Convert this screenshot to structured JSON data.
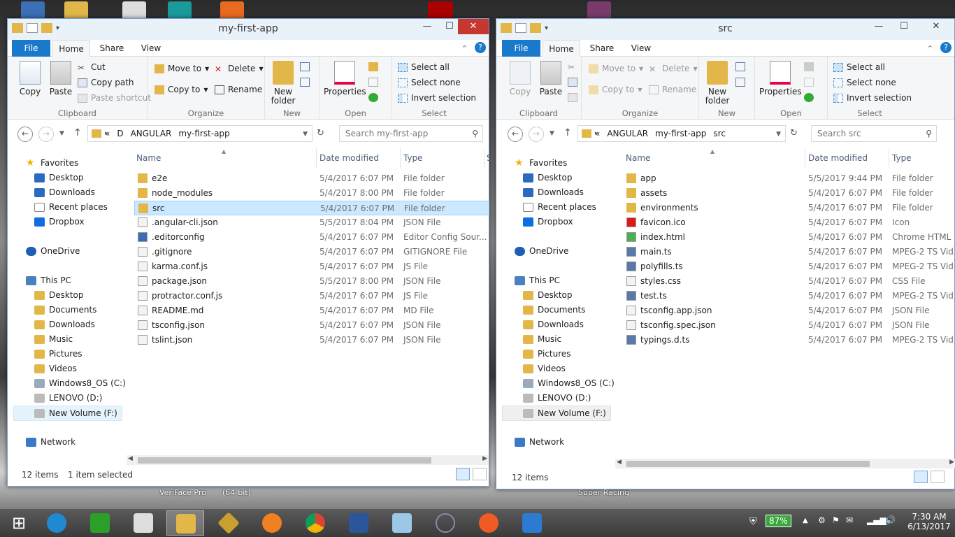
{
  "desktop": {
    "labels": [
      "VeriFace Pro",
      "(64-bit)",
      "Super Racing"
    ]
  },
  "left": {
    "title": "my-first-app",
    "tabs": [
      "File",
      "Home",
      "Share",
      "View"
    ],
    "ribbon": {
      "copy": "Copy",
      "paste": "Paste",
      "cut": "Cut",
      "copy_path": "Copy path",
      "paste_shortcut": "Paste shortcut",
      "clipboard": "Clipboard",
      "move_to": "Move to",
      "copy_to": "Copy to",
      "delete": "Delete",
      "rename": "Rename",
      "organize": "Organize",
      "new_folder": "New folder",
      "new": "New",
      "properties": "Properties",
      "open": "Open",
      "select_all": "Select all",
      "select_none": "Select none",
      "invert": "Invert selection",
      "select": "Select"
    },
    "breadcrumb": [
      "«",
      "D",
      "ANGULAR",
      "my-first-app"
    ],
    "search": "Search my-first-app",
    "nav": [
      "Favorites",
      "Desktop",
      "Downloads",
      "Recent places",
      "Dropbox",
      "OneDrive",
      "This PC",
      "Desktop",
      "Documents",
      "Downloads",
      "Music",
      "Pictures",
      "Videos",
      "Windows8_OS (C:)",
      "LENOVO (D:)",
      "New Volume (F:)",
      "Network"
    ],
    "columns": [
      "Name",
      "Date modified",
      "Type",
      "S"
    ],
    "files": [
      {
        "name": "e2e",
        "date": "5/4/2017 6:07 PM",
        "type": "File folder"
      },
      {
        "name": "node_modules",
        "date": "5/4/2017 8:00 PM",
        "type": "File folder"
      },
      {
        "name": "src",
        "date": "5/4/2017 6:07 PM",
        "type": "File folder"
      },
      {
        "name": ".angular-cli.json",
        "date": "5/5/2017 8:04 PM",
        "type": "JSON File"
      },
      {
        "name": ".editorconfig",
        "date": "5/4/2017 6:07 PM",
        "type": "Editor Config Sour..."
      },
      {
        "name": ".gitignore",
        "date": "5/4/2017 6:07 PM",
        "type": "GITIGNORE File"
      },
      {
        "name": "karma.conf.js",
        "date": "5/4/2017 6:07 PM",
        "type": "JS File"
      },
      {
        "name": "package.json",
        "date": "5/5/2017 8:00 PM",
        "type": "JSON File"
      },
      {
        "name": "protractor.conf.js",
        "date": "5/4/2017 6:07 PM",
        "type": "JS File"
      },
      {
        "name": "README.md",
        "date": "5/4/2017 6:07 PM",
        "type": "MD File"
      },
      {
        "name": "tsconfig.json",
        "date": "5/4/2017 6:07 PM",
        "type": "JSON File"
      },
      {
        "name": "tslint.json",
        "date": "5/4/2017 6:07 PM",
        "type": "JSON File"
      }
    ],
    "status_items": "12 items",
    "status_selected": "1 item selected"
  },
  "right": {
    "title": "src",
    "tabs": [
      "File",
      "Home",
      "Share",
      "View"
    ],
    "breadcrumb": [
      "«",
      "ANGULAR",
      "my-first-app",
      "src"
    ],
    "search": "Search src",
    "columns": [
      "Name",
      "Date modified",
      "Type"
    ],
    "files": [
      {
        "name": "app",
        "date": "5/5/2017 9:44 PM",
        "type": "File folder"
      },
      {
        "name": "assets",
        "date": "5/4/2017 6:07 PM",
        "type": "File folder"
      },
      {
        "name": "environments",
        "date": "5/4/2017 6:07 PM",
        "type": "File folder"
      },
      {
        "name": "favicon.ico",
        "date": "5/4/2017 6:07 PM",
        "type": "Icon"
      },
      {
        "name": "index.html",
        "date": "5/4/2017 6:07 PM",
        "type": "Chrome HTML"
      },
      {
        "name": "main.ts",
        "date": "5/4/2017 6:07 PM",
        "type": "MPEG-2 TS Vid"
      },
      {
        "name": "polyfills.ts",
        "date": "5/4/2017 6:07 PM",
        "type": "MPEG-2 TS Vid"
      },
      {
        "name": "styles.css",
        "date": "5/4/2017 6:07 PM",
        "type": "CSS File"
      },
      {
        "name": "test.ts",
        "date": "5/4/2017 6:07 PM",
        "type": "MPEG-2 TS Vid"
      },
      {
        "name": "tsconfig.app.json",
        "date": "5/4/2017 6:07 PM",
        "type": "JSON File"
      },
      {
        "name": "tsconfig.spec.json",
        "date": "5/4/2017 6:07 PM",
        "type": "JSON File"
      },
      {
        "name": "typings.d.ts",
        "date": "5/4/2017 6:07 PM",
        "type": "MPEG-2 TS Vid"
      }
    ],
    "status_items": "12 items"
  },
  "tray": {
    "battery": "87%",
    "time": "7:30 AM",
    "date": "6/13/2017"
  },
  "colors": {
    "accent": "#1979ca",
    "selection": "#cce8ff",
    "close": "#c7372f"
  }
}
